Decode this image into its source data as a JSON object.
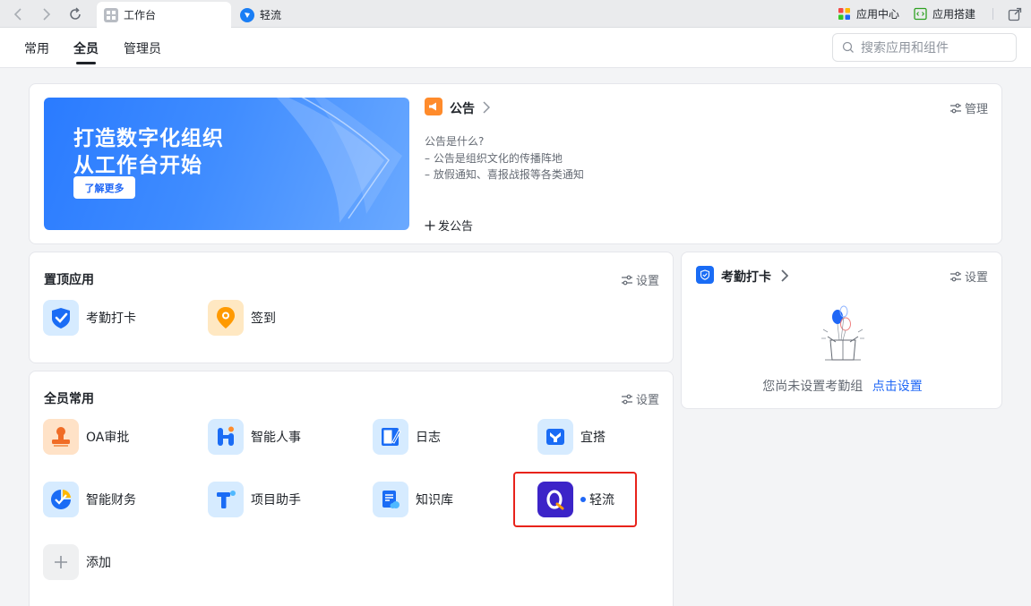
{
  "browser": {
    "tabs": [
      {
        "label": "工作台",
        "icon": "grid-icon"
      },
      {
        "label": "轻流",
        "icon": "qingflow-logo-icon"
      }
    ],
    "right": [
      {
        "label": "应用中心",
        "icon": "app-center-icon"
      },
      {
        "label": "应用搭建",
        "icon": "code-block-icon"
      }
    ]
  },
  "subnav": {
    "tabs": [
      "常用",
      "全员",
      "管理员"
    ],
    "active": "全员",
    "search_placeholder": "搜索应用和组件"
  },
  "colors": {
    "accent": "#1f67f6",
    "highlight": "#e8231b"
  },
  "banner": {
    "line1": "打造数字化组织",
    "line2": "从工作台开始",
    "button": "了解更多"
  },
  "notice": {
    "title": "公告",
    "manage": "管理",
    "lines": [
      "公告是什么?",
      "– 公告是组织文化的传播阵地",
      "– 放假通知、喜报战报等各类通知"
    ],
    "post": "发公告"
  },
  "pinned": {
    "title": "置顶应用",
    "settings": "设置",
    "apps": [
      {
        "label": "考勤打卡",
        "icon": "attendance-check-icon"
      },
      {
        "label": "签到",
        "icon": "location-pin-icon"
      }
    ]
  },
  "common": {
    "title": "全员常用",
    "settings": "设置",
    "apps": [
      {
        "label": "OA审批",
        "icon": "stamp-icon"
      },
      {
        "label": "智能人事",
        "icon": "hr-icon"
      },
      {
        "label": "日志",
        "icon": "journal-icon"
      },
      {
        "label": "宜搭",
        "icon": "yida-icon"
      },
      {
        "label": "智能财务",
        "icon": "finance-icon"
      },
      {
        "label": "项目助手",
        "icon": "project-icon"
      },
      {
        "label": "知识库",
        "icon": "knowledge-icon"
      },
      {
        "label": "轻流",
        "icon": "qingflow-app-icon"
      },
      {
        "label": "添加",
        "icon": "plus-icon"
      }
    ]
  },
  "attendance": {
    "title": "考勤打卡",
    "settings": "设置",
    "empty_text": "您尚未设置考勤组",
    "empty_link": "点击设置"
  }
}
